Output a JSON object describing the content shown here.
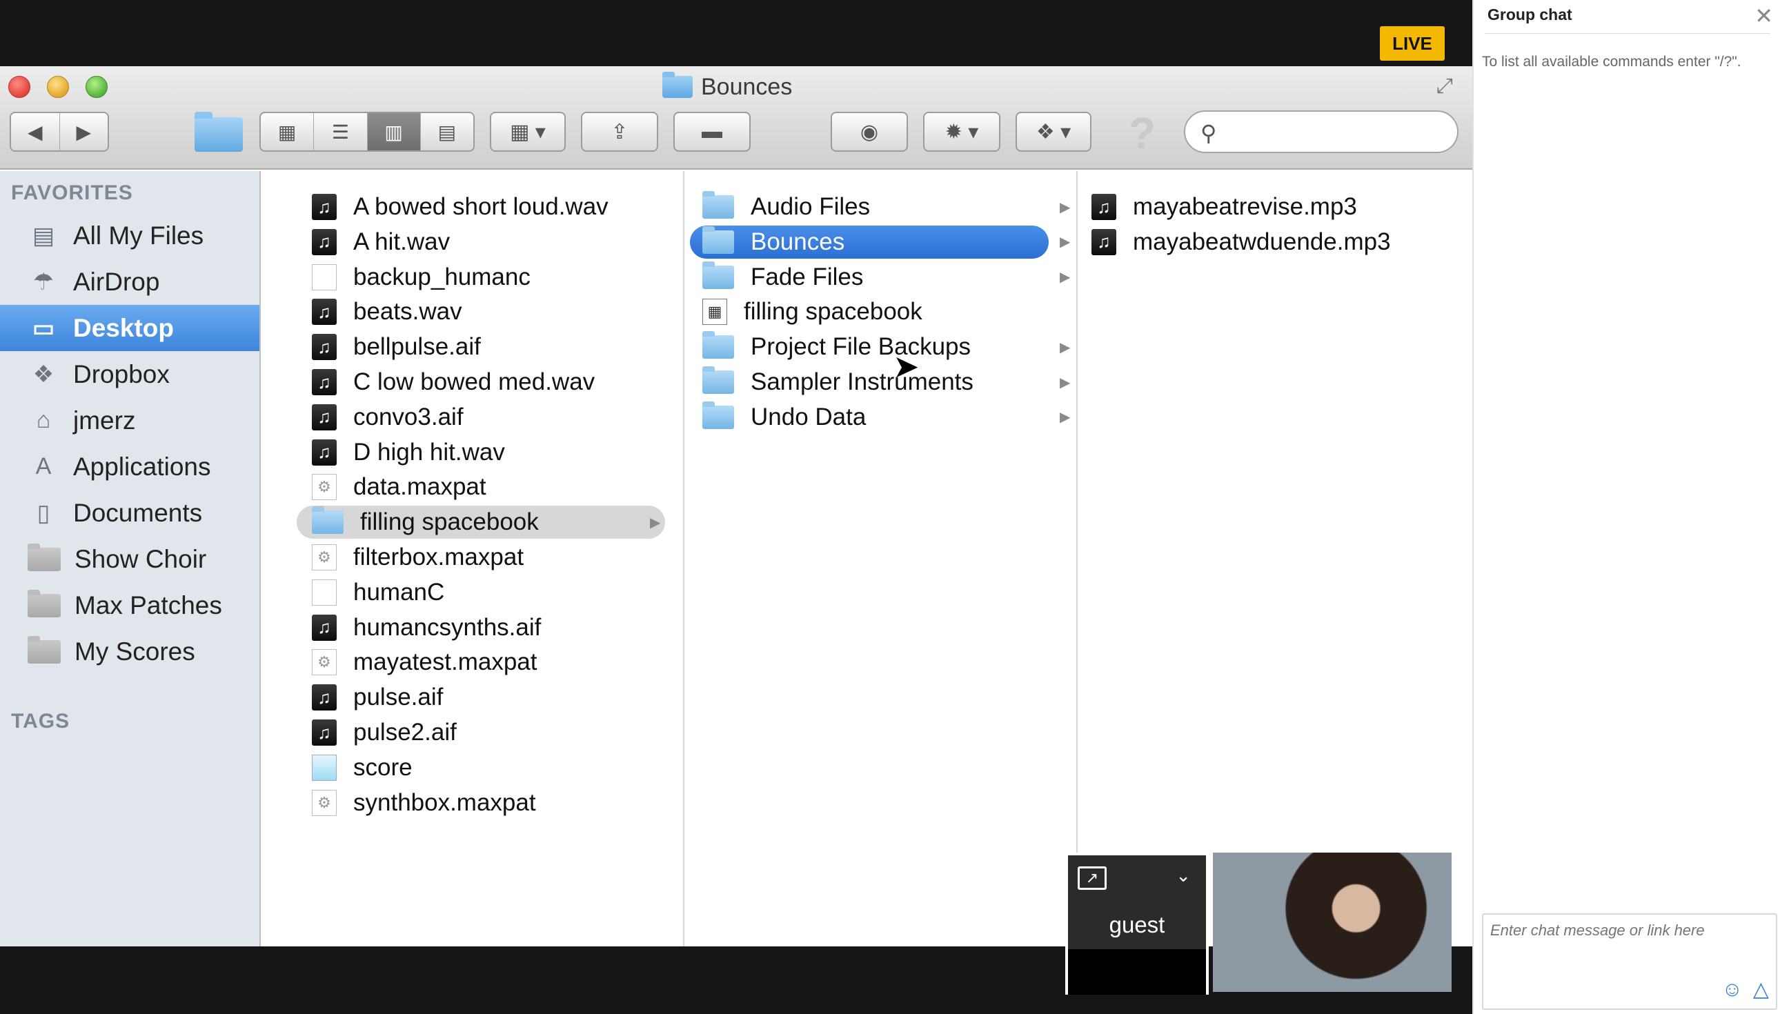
{
  "live_badge": "LIVE",
  "window": {
    "title": "Bounces"
  },
  "sidebar": {
    "favorites_header": "FAVORITES",
    "items": [
      {
        "label": "All My Files",
        "icon": "all-files-icon"
      },
      {
        "label": "AirDrop",
        "icon": "airdrop-icon"
      },
      {
        "label": "Desktop",
        "icon": "desktop-icon"
      },
      {
        "label": "Dropbox",
        "icon": "dropbox-icon"
      },
      {
        "label": "jmerz",
        "icon": "home-icon"
      },
      {
        "label": "Applications",
        "icon": "applications-icon"
      },
      {
        "label": "Documents",
        "icon": "documents-icon"
      },
      {
        "label": "Show Choir",
        "icon": "folder-icon"
      },
      {
        "label": "Max Patches",
        "icon": "folder-icon"
      },
      {
        "label": "My Scores",
        "icon": "folder-icon"
      }
    ],
    "tags_header": "TAGS"
  },
  "column1": [
    {
      "name": "A bowed short loud.wav",
      "type": "audio"
    },
    {
      "name": "A hit.wav",
      "type": "audio"
    },
    {
      "name": "backup_humanc",
      "type": "doc"
    },
    {
      "name": "beats.wav",
      "type": "audio"
    },
    {
      "name": "bellpulse.aif",
      "type": "audio"
    },
    {
      "name": "C low bowed med.wav",
      "type": "audio"
    },
    {
      "name": "convo3.aif",
      "type": "audio"
    },
    {
      "name": "D high hit.wav",
      "type": "audio"
    },
    {
      "name": "data.maxpat",
      "type": "maxpat"
    },
    {
      "name": "filling spacebook",
      "type": "folder"
    },
    {
      "name": "filterbox.maxpat",
      "type": "maxpat"
    },
    {
      "name": "humanC",
      "type": "doc"
    },
    {
      "name": "humancsynths.aif",
      "type": "audio"
    },
    {
      "name": "mayatest.maxpat",
      "type": "maxpat"
    },
    {
      "name": "pulse.aif",
      "type": "audio"
    },
    {
      "name": "pulse2.aif",
      "type": "audio"
    },
    {
      "name": "score",
      "type": "score"
    },
    {
      "name": "synthbox.maxpat",
      "type": "maxpat"
    }
  ],
  "column2": [
    {
      "name": "Audio Files",
      "type": "folder"
    },
    {
      "name": "Bounces",
      "type": "folder"
    },
    {
      "name": "Fade Files",
      "type": "folder"
    },
    {
      "name": "filling spacebook",
      "type": "logic"
    },
    {
      "name": "Project File Backups",
      "type": "folder"
    },
    {
      "name": "Sampler Instruments",
      "type": "folder"
    },
    {
      "name": "Undo Data",
      "type": "folder"
    }
  ],
  "column3": [
    {
      "name": "mayabeatrevise.mp3",
      "type": "audio"
    },
    {
      "name": "mayabeatwduende.mp3",
      "type": "audio"
    }
  ],
  "video": {
    "guest_name": "guest"
  },
  "chat": {
    "title": "Group chat",
    "info": "To list all available commands enter \"/?\".",
    "input_placeholder": "Enter chat message or link here"
  }
}
